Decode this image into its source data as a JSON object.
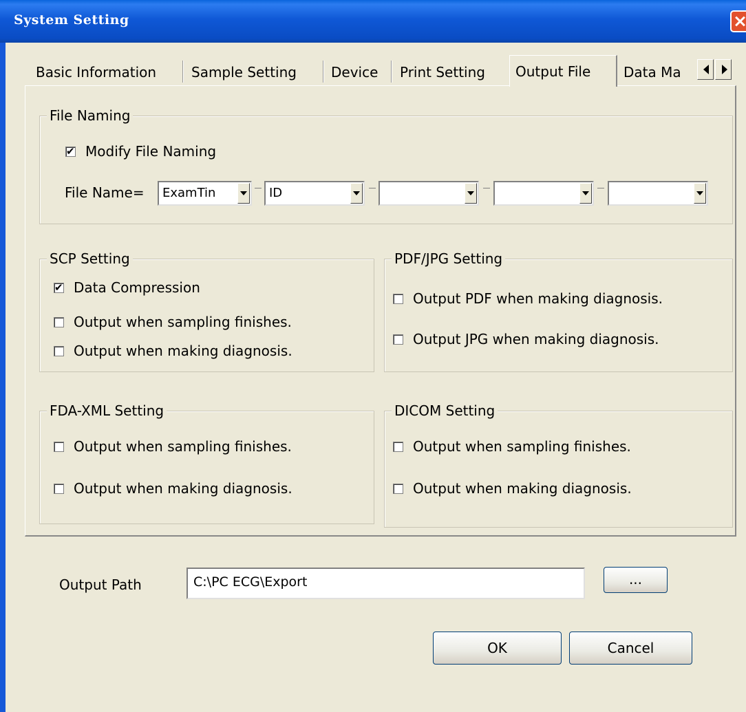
{
  "window": {
    "title": "System Setting"
  },
  "tabs": [
    "Basic Information",
    "Sample Setting",
    "Device",
    "Print Setting",
    "Output File",
    "Data Ma"
  ],
  "active_tab": "Output File",
  "file_naming": {
    "legend": "File Naming",
    "modify_label": "Modify File Naming",
    "modify_checked": true,
    "file_name_label": "File Name=",
    "fields": [
      "ExamTin",
      "ID",
      "",
      "",
      ""
    ]
  },
  "scp": {
    "legend": "SCP Setting",
    "data_compression": "Data Compression",
    "output_sampling": "Output when sampling finishes.",
    "output_diagnosis": "Output when making diagnosis."
  },
  "pdf_jpg": {
    "legend": "PDF/JPG Setting",
    "output_pdf": "Output PDF when making diagnosis.",
    "output_jpg": "Output JPG when making diagnosis."
  },
  "fda_xml": {
    "legend": "FDA-XML Setting",
    "output_sampling": "Output when sampling finishes.",
    "output_diagnosis": "Output when making diagnosis."
  },
  "dicom": {
    "legend": "DICOM Setting",
    "output_sampling": "Output when sampling finishes.",
    "output_diagnosis": "Output when making diagnosis."
  },
  "output_path": {
    "label": "Output Path",
    "value": "C:\\PC ECG\\Export",
    "browse_label": "..."
  },
  "buttons": {
    "ok": "OK",
    "cancel": "Cancel"
  }
}
